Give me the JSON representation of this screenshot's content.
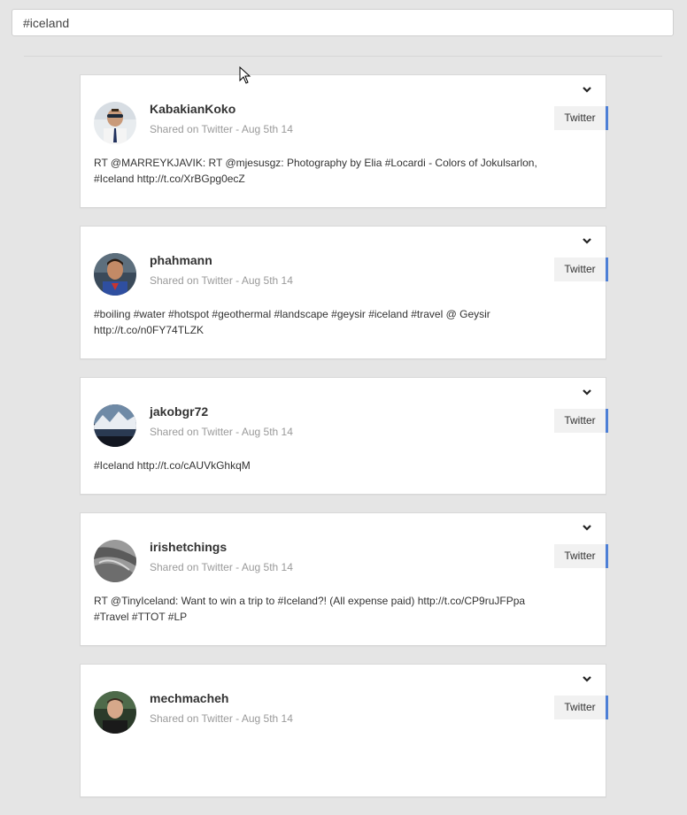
{
  "search": {
    "value": "#iceland"
  },
  "posts": [
    {
      "username": "KabakianKoko",
      "meta": "Shared on Twitter - Aug 5th 14",
      "source": "Twitter",
      "text_line1": "RT @MARREYKJAVIK: RT @mjesusgz: Photography by Elia #Locardi - Colors of Jokulsarlon,",
      "text_line2": "#Iceland http://t.co/XrBGpg0ecZ"
    },
    {
      "username": "phahmann",
      "meta": "Shared on Twitter - Aug 5th 14",
      "source": "Twitter",
      "text_line1": "#boiling #water #hotspot #geothermal #landscape #geysir #iceland #travel @ Geysir",
      "text_line2": "http://t.co/n0FY74TLZK"
    },
    {
      "username": "jakobgr72",
      "meta": "Shared on Twitter - Aug 5th 14",
      "source": "Twitter",
      "text_line1": "#Iceland http://t.co/cAUVkGhkqM",
      "text_line2": ""
    },
    {
      "username": "irishetchings",
      "meta": "Shared on Twitter - Aug 5th 14",
      "source": "Twitter",
      "text_line1": "RT @TinyIceland: Want to win a trip to #Iceland?! (All expense paid) http://t.co/CP9ruJFPpa",
      "text_line2": "#Travel #TTOT #LP"
    },
    {
      "username": "mechmacheh",
      "meta": "Shared on Twitter - Aug 5th 14",
      "source": "Twitter",
      "text_line1": "",
      "text_line2": ""
    }
  ],
  "colors": {
    "background": "#e5e5e5",
    "accent": "#4d7fd6",
    "card": "#ffffff"
  },
  "icons": {
    "chevron": "chevron-down-icon",
    "cursor": "mouse-cursor-icon"
  }
}
